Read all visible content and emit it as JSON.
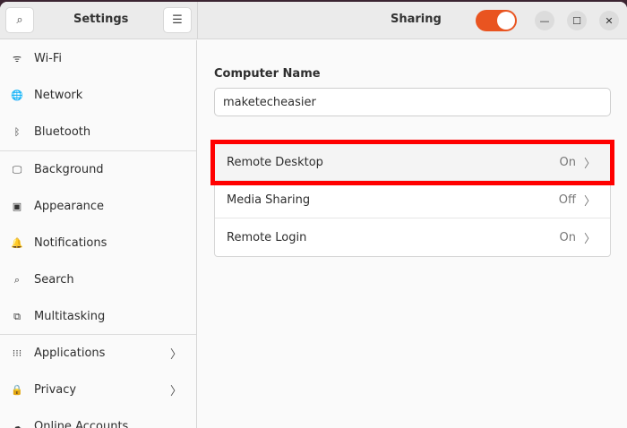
{
  "header": {
    "sidebar_title": "Settings",
    "page_title": "Sharing",
    "sharing_enabled": true
  },
  "sidebar": {
    "items": [
      {
        "label": "Wi-Fi",
        "icon": "wifi-icon",
        "glyph": "ᯤ"
      },
      {
        "label": "Network",
        "icon": "globe-icon",
        "glyph": "🌐"
      },
      {
        "label": "Bluetooth",
        "icon": "bluetooth-icon",
        "glyph": "ᛒ"
      },
      {
        "label": "Background",
        "icon": "background-icon",
        "glyph": "🖵"
      },
      {
        "label": "Appearance",
        "icon": "appearance-icon",
        "glyph": "▣"
      },
      {
        "label": "Notifications",
        "icon": "bell-icon",
        "glyph": "🔔"
      },
      {
        "label": "Search",
        "icon": "search-icon",
        "glyph": "⌕"
      },
      {
        "label": "Multitasking",
        "icon": "multitasking-icon",
        "glyph": "⧉"
      },
      {
        "label": "Applications",
        "icon": "apps-icon",
        "glyph": "⁝⁝⁝"
      },
      {
        "label": "Privacy",
        "icon": "lock-icon",
        "glyph": "🔒"
      },
      {
        "label": "Online Accounts",
        "icon": "accounts-icon",
        "glyph": "☁"
      }
    ]
  },
  "main": {
    "computer_name_label": "Computer Name",
    "computer_name_value": "maketecheasier",
    "rows": [
      {
        "label": "Remote Desktop",
        "value": "On"
      },
      {
        "label": "Media Sharing",
        "value": "Off"
      },
      {
        "label": "Remote Login",
        "value": "On"
      }
    ]
  },
  "colors": {
    "accent": "#e95420",
    "highlight": "#ff0000"
  }
}
